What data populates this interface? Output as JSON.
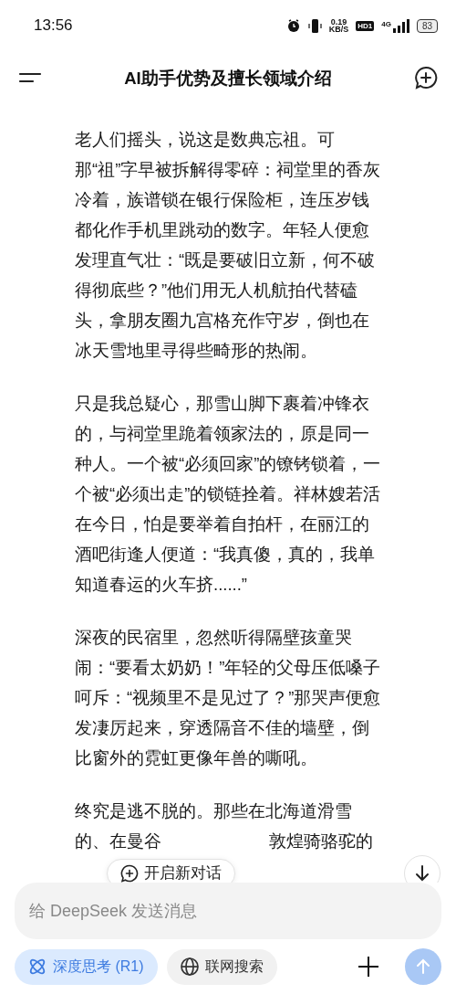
{
  "status_bar": {
    "time": "13:56",
    "net_speed": "0.19",
    "net_unit": "KB/S",
    "hd": "HD1",
    "network": "4G",
    "battery": "83"
  },
  "header": {
    "title": "AI助手优势及擅长领域介绍"
  },
  "paragraphs": [
    "老人们摇头，说这是数典忘祖。可那“祖”字早被拆解得零碎：祠堂里的香灰冷着，族谱锁在银行保险柜，连压岁钱都化作手机里跳动的数字。年轻人便愈发理直气壮：“既是要破旧立新，何不破得彻底些？”他们用无人机航拍代替磕头，拿朋友圈九宫格充作守岁，倒也在冰天雪地里寻得些畸形的热闹。",
    "只是我总疑心，那雪山脚下裹着冲锋衣的，与祠堂里跪着领家法的，原是同一种人。一个被“必须回家”的镣铐锁着，一个被“必须出走”的锁链拴着。祥林嫂若活在今日，怕是要举着自拍杆，在丽江的酒吧街逢人便道：“我真傻，真的，我单知道春运的火车挤......”",
    "深夜的民宿里，忽然听得隔壁孩童哭闹：“要看太奶奶！”年轻的父母压低嗓子呵斥：“视频里不是见过了？”那哭声便愈发凄厉起来，穿透隔音不佳的墙壁，倒比窗外的霓虹更像年兽的嘶吼。"
  ],
  "last_paragraph": {
    "line_1": "终究是逃不脱的。那些在北海道滑雪",
    "line_2_start": "的、在曼谷",
    "line_2_end": "敦煌骑骆驼的"
  },
  "new_chat_button": {
    "label": "开启新对话"
  },
  "composer": {
    "placeholder": "给 DeepSeek 发送消息",
    "toggles": [
      {
        "kind": "think",
        "label": "深度思考 (R1)",
        "selected": true
      },
      {
        "kind": "web",
        "label": "联网搜索",
        "selected": false
      }
    ],
    "send_button": {
      "disabled": true
    }
  }
}
